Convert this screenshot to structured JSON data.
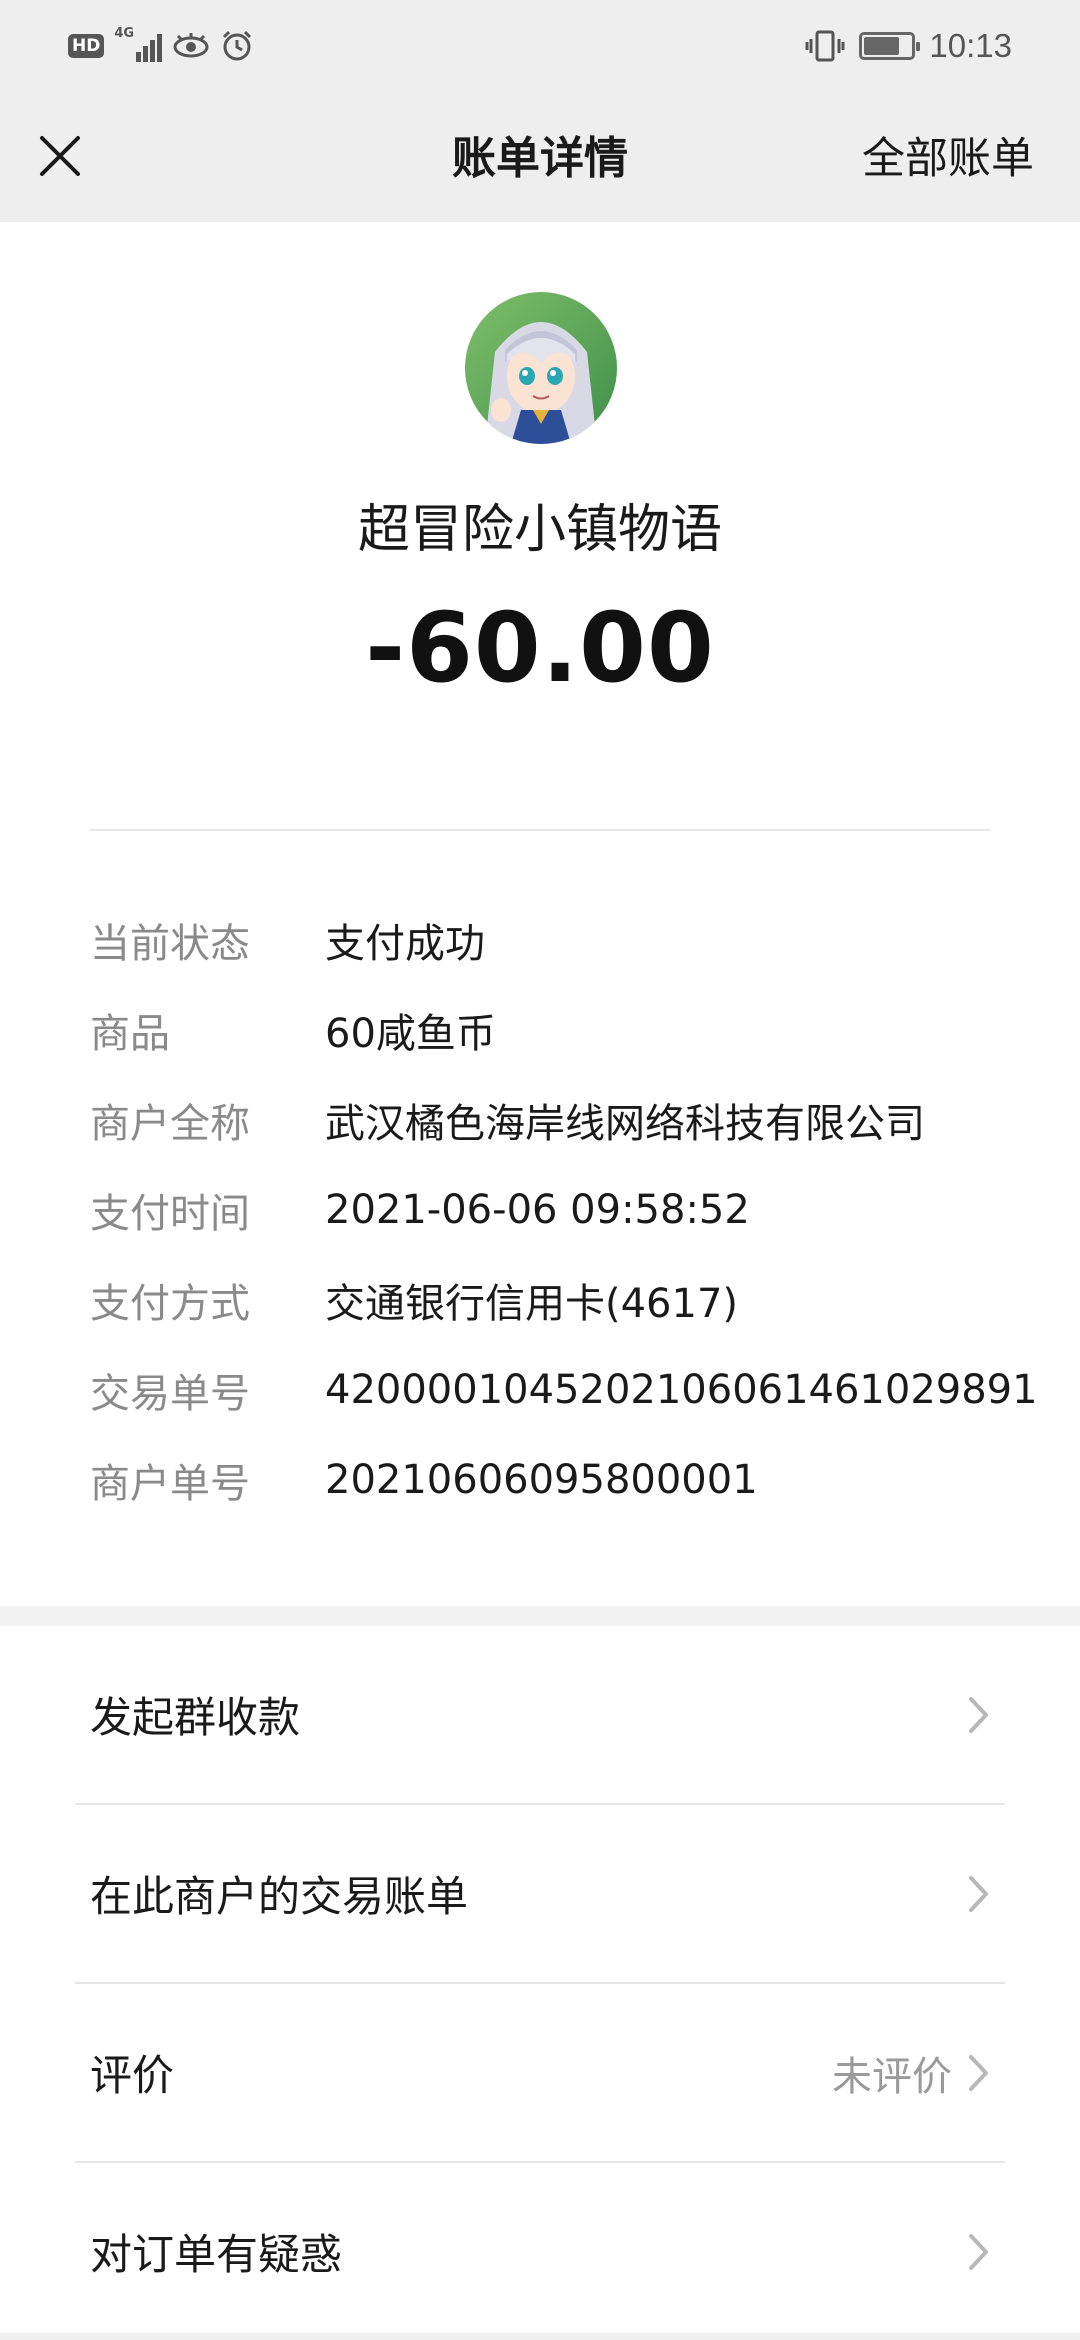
{
  "status_bar": {
    "hd_badge": "HD",
    "network": "4G",
    "time": "10:13",
    "battery_level": 0.75,
    "icons": [
      "hd-icon",
      "signal-icon",
      "eye-icon",
      "alarm-icon",
      "vibrate-icon",
      "battery-icon"
    ]
  },
  "nav": {
    "title": "账单详情",
    "action": "全部账单",
    "close_icon": "close-icon"
  },
  "header": {
    "merchant_name": "超冒险小镇物语",
    "amount": "-60.00"
  },
  "details": [
    {
      "label": "当前状态",
      "value": "支付成功"
    },
    {
      "label": "商品",
      "value": "60咸鱼币"
    },
    {
      "label": "商户全称",
      "value": "武汉橘色海岸线网络科技有限公司"
    },
    {
      "label": "支付时间",
      "value": "2021-06-06 09:58:52"
    },
    {
      "label": "支付方式",
      "value": "交通银行信用卡(4617)"
    },
    {
      "label": "交易单号",
      "value": "4200001045202106061461029891"
    },
    {
      "label": "商户单号",
      "value": "20210606095800001"
    }
  ],
  "menu": [
    {
      "label": "发起群收款",
      "extra": ""
    },
    {
      "label": "在此商户的交易账单",
      "extra": ""
    },
    {
      "label": "评价",
      "extra": "未评价"
    },
    {
      "label": "对订单有疑惑",
      "extra": ""
    }
  ],
  "colors": {
    "bar_bg": "#eeeeee",
    "label_gray": "#8a8a8a",
    "chevron": "#b8b8b8"
  }
}
